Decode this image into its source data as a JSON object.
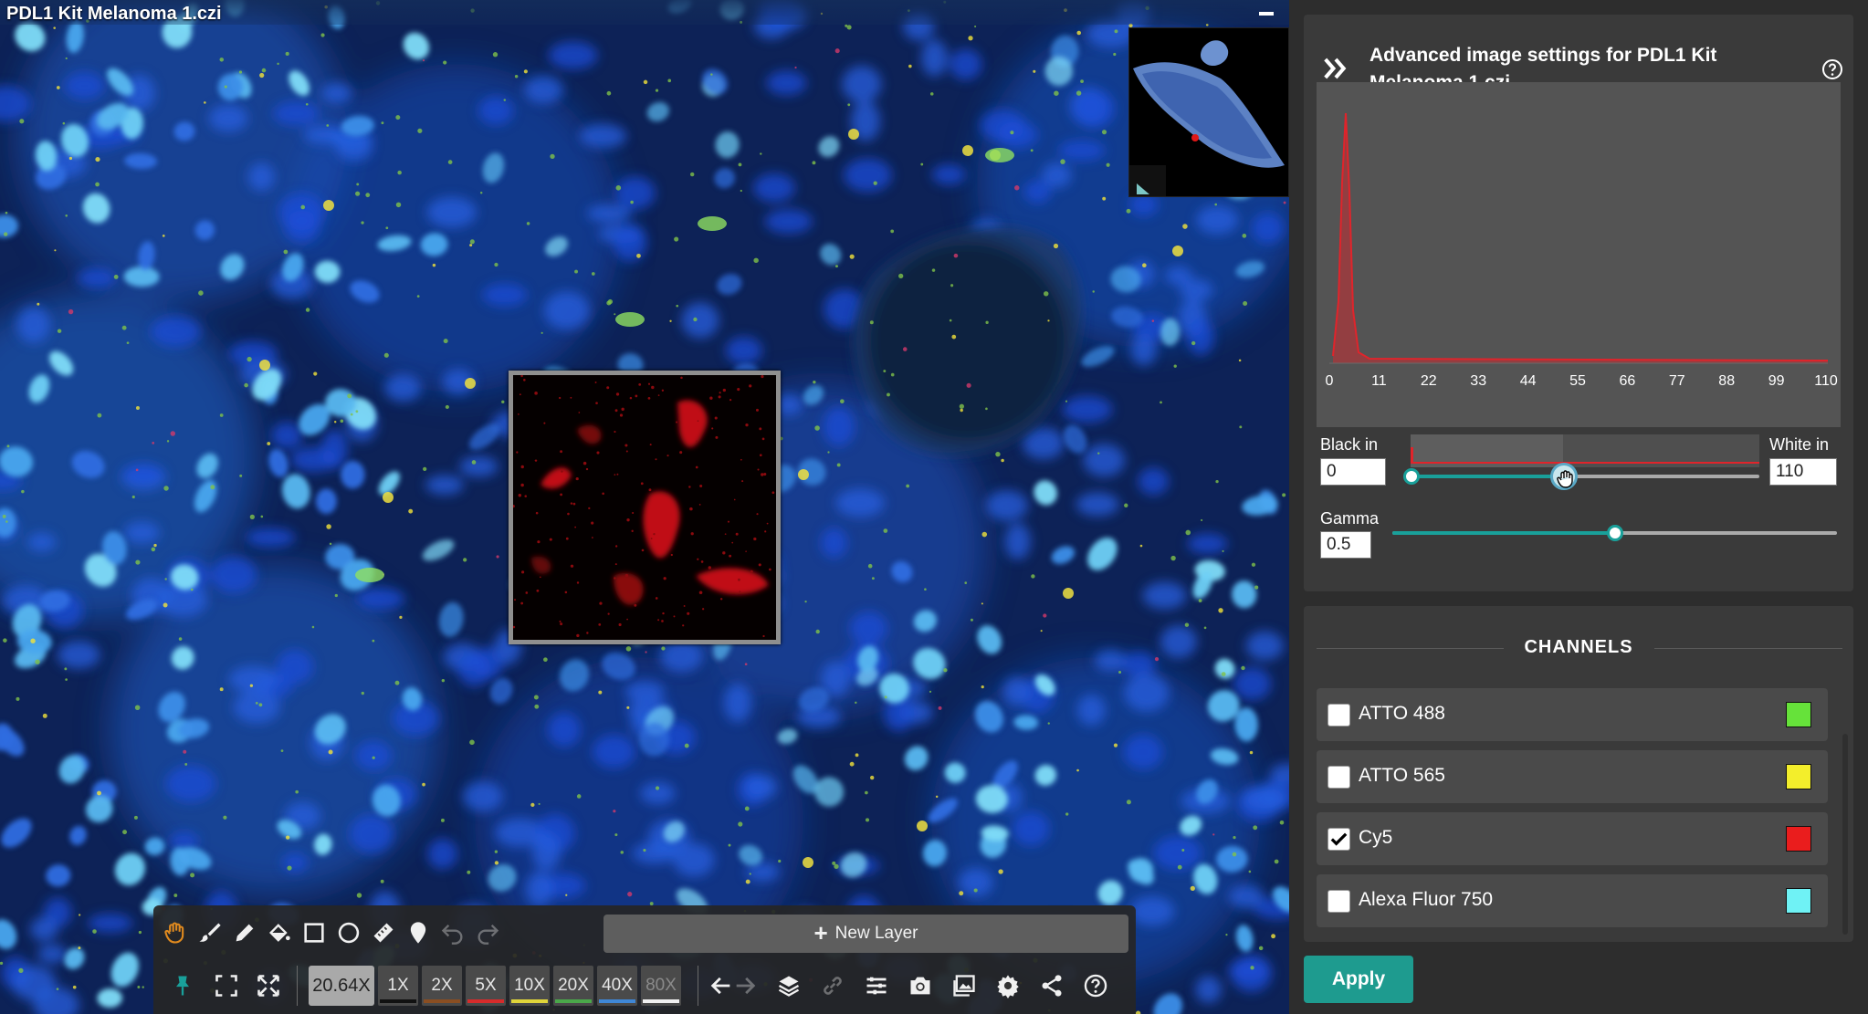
{
  "viewer": {
    "title": "PDL1 Kit Melanoma 1.czi"
  },
  "toolbar": {
    "new_layer_label": "New Layer",
    "zoom_readout": "20.64X",
    "zoom_buttons": [
      {
        "label": "1X",
        "color": "#111111"
      },
      {
        "label": "2X",
        "color": "#8a4e22"
      },
      {
        "label": "5X",
        "color": "#d62b2b"
      },
      {
        "label": "10X",
        "color": "#e0d43a"
      },
      {
        "label": "20X",
        "color": "#4aa84a"
      },
      {
        "label": "40X",
        "color": "#3f87d6"
      },
      {
        "label": "80X",
        "color": "#f0f0f0"
      }
    ],
    "tools_row1": [
      "hand-icon",
      "brush-icon",
      "pencil-icon",
      "fill-bucket-icon",
      "rectangle-icon",
      "ellipse-icon",
      "ruler-icon",
      "map-marker-icon",
      "undo-icon",
      "redo-icon"
    ],
    "tools_row2": [
      "pin-icon",
      "fit-screen-icon",
      "fullscreen-icon",
      "back-arrow-icon",
      "forward-arrow-icon",
      "layers-icon",
      "link-icon",
      "list-icon",
      "camera-icon",
      "gallery-icon",
      "settings-icon",
      "share-icon",
      "help-icon"
    ]
  },
  "settings": {
    "title": "Advanced image settings for PDL1 Kit Melanoma 1.czi",
    "histogram": {
      "ticks": [
        "0",
        "11",
        "22",
        "33",
        "44",
        "55",
        "66",
        "77",
        "88",
        "99",
        "110"
      ],
      "curve_color": "#e0242b"
    },
    "black_in_label": "Black in",
    "black_in_value": "0",
    "white_in_label": "White in",
    "white_in_value": "110",
    "gamma_label": "Gamma",
    "gamma_value": "0.5",
    "accent": "#19a09a"
  },
  "channels": {
    "heading": "CHANNELS",
    "items": [
      {
        "label": "ATTO 488",
        "checked": false,
        "color": "#66e23a"
      },
      {
        "label": "ATTO 565",
        "checked": false,
        "color": "#f3ee2b"
      },
      {
        "label": "Cy5",
        "checked": true,
        "color": "#ea1d1d"
      },
      {
        "label": "Alexa Fluor 750",
        "checked": false,
        "color": "#6ff2f5"
      }
    ]
  },
  "apply_label": "Apply"
}
